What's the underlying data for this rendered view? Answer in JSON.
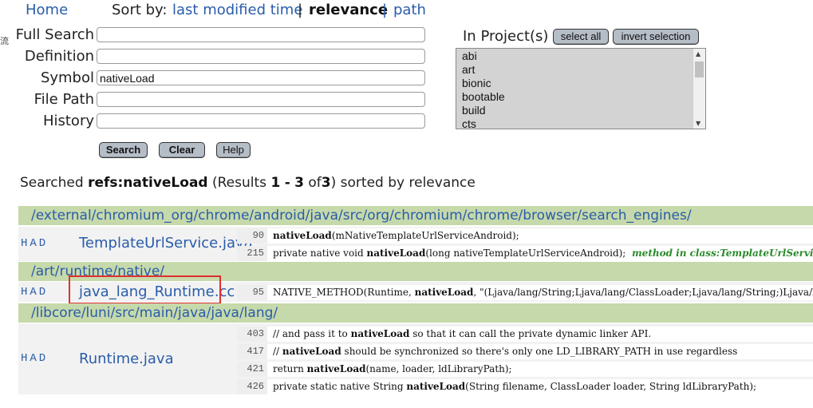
{
  "edge_glyph": "流",
  "nav": {
    "home": "Home",
    "sort_by": "Sort by:",
    "last_modified": "last modified time",
    "separator": "|",
    "relevance": "relevance",
    "path": "path"
  },
  "form": {
    "full_search": {
      "label": "Full Search",
      "value": ""
    },
    "definition": {
      "label": "Definition",
      "value": ""
    },
    "symbol": {
      "label": "Symbol",
      "value": "nativeLoad"
    },
    "file_path": {
      "label": "File Path",
      "value": ""
    },
    "history": {
      "label": "History",
      "value": ""
    },
    "search_button": "Search",
    "clear_button": "Clear",
    "help_button": "Help"
  },
  "projects": {
    "label": "In Project(s)",
    "select_all": "select all",
    "invert_selection": "invert selection",
    "items": [
      "abi",
      "art",
      "bionic",
      "bootable",
      "build",
      "cts"
    ]
  },
  "summary": {
    "prefix": "Searched",
    "query": "refs:nativeLoad",
    "results_open": "(Results",
    "from": "1",
    "dash": "-",
    "to": "3",
    "of": "of",
    "total": "3",
    "suffix": ") sorted by relevance"
  },
  "results": [
    {
      "dir": "/external/chromium_org/chrome/android/java/src/org/chromium/chrome/browser/search_engines/",
      "had": "HAD",
      "file": "TemplateUrlService.java",
      "lines": [
        {
          "num": "90",
          "pre": "",
          "hit": "nativeLoad",
          "post": "(mNativeTemplateUrlServiceAndroid);",
          "scope": ""
        },
        {
          "num": "215",
          "pre": "private native void ",
          "hit": "nativeLoad",
          "post": "(long nativeTemplateUrlServiceAndroid);  ",
          "scope": "method in class:TemplateUrlService"
        }
      ]
    },
    {
      "dir": "/art/runtime/native/",
      "had": "HAD",
      "file": "java_lang_Runtime.cc",
      "lines": [
        {
          "num": "95",
          "pre": "NATIVE_METHOD(Runtime, ",
          "hit": "nativeLoad",
          "post": ", \"(Ljava/lang/String;Ljava/lang/ClassLoader;Ljava/lang/String;)Ljava/lang/String;\"),",
          "scope": ""
        }
      ]
    },
    {
      "dir": "/libcore/luni/src/main/java/java/lang/",
      "had": "HAD",
      "file": "Runtime.java",
      "lines": [
        {
          "num": "403",
          "pre": "// and pass it to ",
          "hit": "nativeLoad",
          "post": " so that it can call the private dynamic linker API.",
          "scope": ""
        },
        {
          "num": "417",
          "pre": "// ",
          "hit": "nativeLoad",
          "post": " should be synchronized so there's only one LD_LIBRARY_PATH in use regardless",
          "scope": ""
        },
        {
          "num": "421",
          "pre": "return ",
          "hit": "nativeLoad",
          "post": "(name, loader, ldLibraryPath);",
          "scope": ""
        },
        {
          "num": "426",
          "pre": "private static native String ",
          "hit": "nativeLoad",
          "post": "(String filename, ClassLoader loader, String ldLibraryPath);",
          "scope": ""
        }
      ]
    }
  ]
}
